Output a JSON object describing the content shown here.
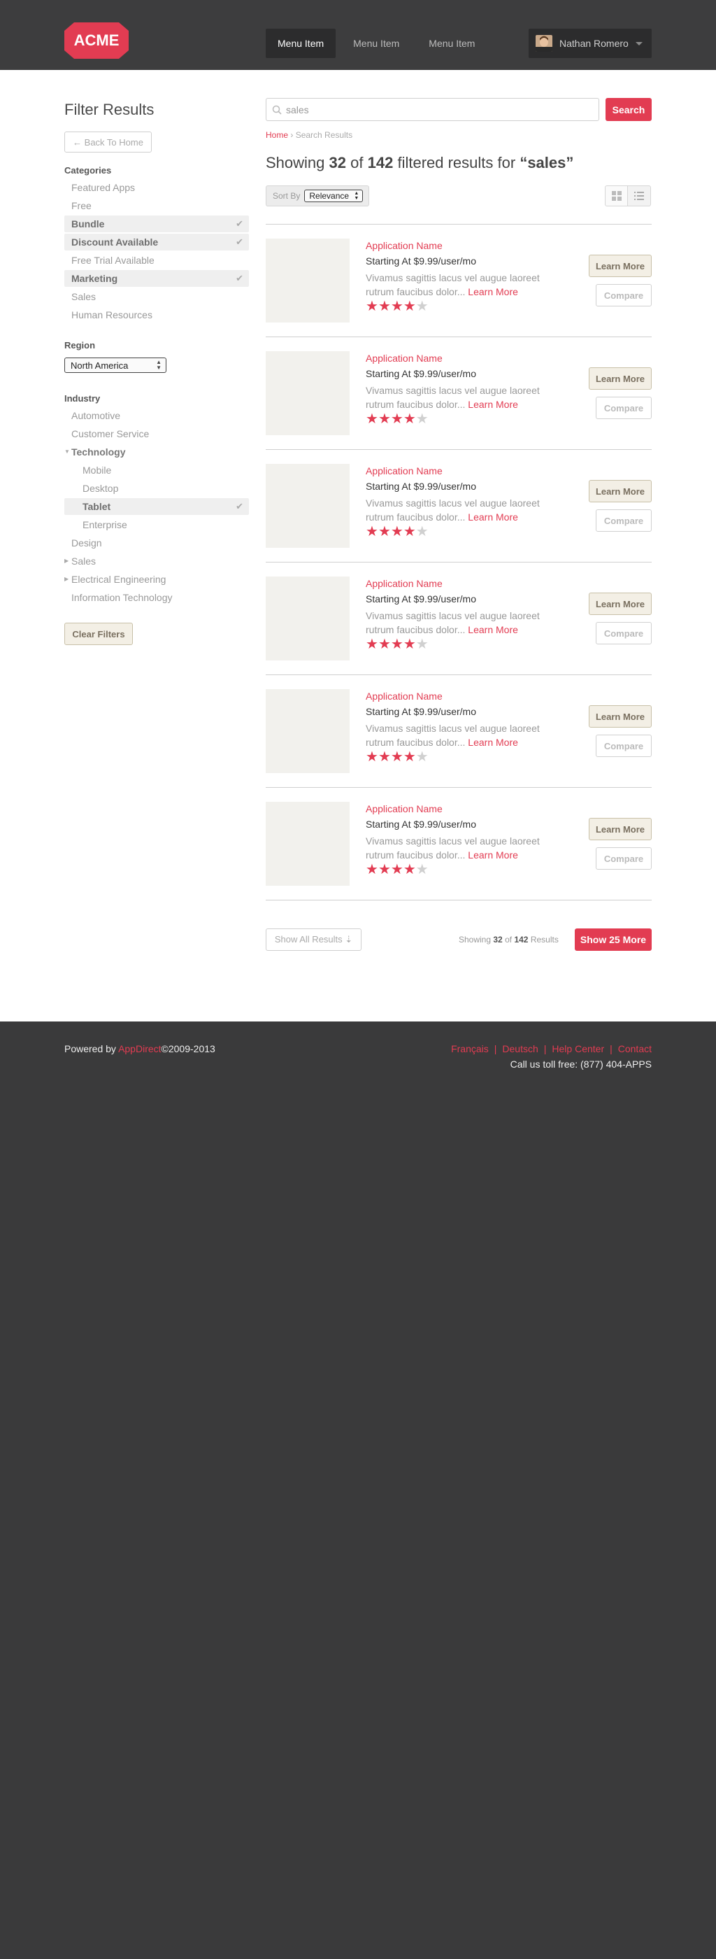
{
  "header": {
    "logo_text": "ACME",
    "nav": [
      "Menu Item",
      "Menu Item",
      "Menu Item"
    ],
    "active_nav_index": 0,
    "user_name": "Nathan Romero"
  },
  "sidebar": {
    "title": "Filter Results",
    "back_label": "← Back To Home",
    "categories_label": "Categories",
    "categories": [
      {
        "label": "Featured Apps",
        "checked": false
      },
      {
        "label": "Free",
        "checked": false
      },
      {
        "label": "Bundle",
        "checked": true
      },
      {
        "label": "Discount Available",
        "checked": true
      },
      {
        "label": "Free Trial Available",
        "checked": false
      },
      {
        "label": "Marketing",
        "checked": true
      },
      {
        "label": "Sales",
        "checked": false
      },
      {
        "label": "Human Resources",
        "checked": false
      }
    ],
    "region_label": "Region",
    "region_value": "North America",
    "industry_label": "Industry",
    "industry": [
      {
        "label": "Automotive"
      },
      {
        "label": "Customer Service"
      },
      {
        "label": "Technology",
        "expanded": true
      },
      {
        "label": "Mobile",
        "level": 2
      },
      {
        "label": "Desktop",
        "level": 2
      },
      {
        "label": "Tablet",
        "level": 2,
        "checked": true
      },
      {
        "label": "Enterprise",
        "level": 2
      },
      {
        "label": "Design"
      },
      {
        "label": "Sales",
        "collapsed": true
      },
      {
        "label": "Electrical Engineering",
        "collapsed": true
      },
      {
        "label": "Information Technology"
      }
    ],
    "clear_label": "Clear Filters"
  },
  "search": {
    "value": "sales",
    "button_label": "Search"
  },
  "breadcrumb": {
    "home": "Home",
    "separator": "›",
    "current": "Search Results"
  },
  "summary": {
    "prefix": "Showing",
    "shown": "32",
    "of_word": "of",
    "total": "142",
    "suffix": "filtered results for",
    "query": "“sales”"
  },
  "sort": {
    "label": "Sort By",
    "value": "Relevance"
  },
  "results": [
    {
      "name": "Application Name",
      "price": "Starting At $9.99/user/mo",
      "desc": "Vivamus sagittis lacus vel augue laoreet rutrum faucibus dolor...",
      "more": "Learn More",
      "rating": 4,
      "learn": "Learn More",
      "compare": "Compare"
    },
    {
      "name": "Application Name",
      "price": "Starting At $9.99/user/mo",
      "desc": "Vivamus sagittis lacus vel augue laoreet rutrum faucibus dolor...",
      "more": "Learn More",
      "rating": 4,
      "learn": "Learn More",
      "compare": "Compare"
    },
    {
      "name": "Application Name",
      "price": "Starting At $9.99/user/mo",
      "desc": "Vivamus sagittis lacus vel augue laoreet rutrum faucibus dolor...",
      "more": "Learn More",
      "rating": 4,
      "learn": "Learn More",
      "compare": "Compare"
    },
    {
      "name": "Application Name",
      "price": "Starting At $9.99/user/mo",
      "desc": "Vivamus sagittis lacus vel augue laoreet rutrum faucibus dolor...",
      "more": "Learn More",
      "rating": 4,
      "learn": "Learn More",
      "compare": "Compare"
    },
    {
      "name": "Application Name",
      "price": "Starting At $9.99/user/mo",
      "desc": "Vivamus sagittis lacus vel augue laoreet rutrum faucibus dolor...",
      "more": "Learn More",
      "rating": 4,
      "learn": "Learn More",
      "compare": "Compare"
    },
    {
      "name": "Application Name",
      "price": "Starting At $9.99/user/mo",
      "desc": "Vivamus sagittis lacus vel augue laoreet rutrum faucibus dolor...",
      "more": "Learn More",
      "rating": 4,
      "learn": "Learn More",
      "compare": "Compare"
    }
  ],
  "pager": {
    "show_all": "Show All Results ⇣",
    "prefix": "Showing",
    "shown": "32",
    "of_word": "of",
    "total": "142",
    "suffix": "Results",
    "more_label": "Show 25 More"
  },
  "footer": {
    "powered_prefix": "Powered by",
    "brand": "AppDirect",
    "copyright": "©2009-2013",
    "links": [
      "Français",
      "Deutsch",
      "Help Center",
      "Contact"
    ],
    "tollfree": "Call us toll free: (877) 404-APPS"
  },
  "colors": {
    "accent": "#e23c52",
    "header_bg": "#3d3d3e",
    "footer_bg": "#3a3a3b"
  }
}
